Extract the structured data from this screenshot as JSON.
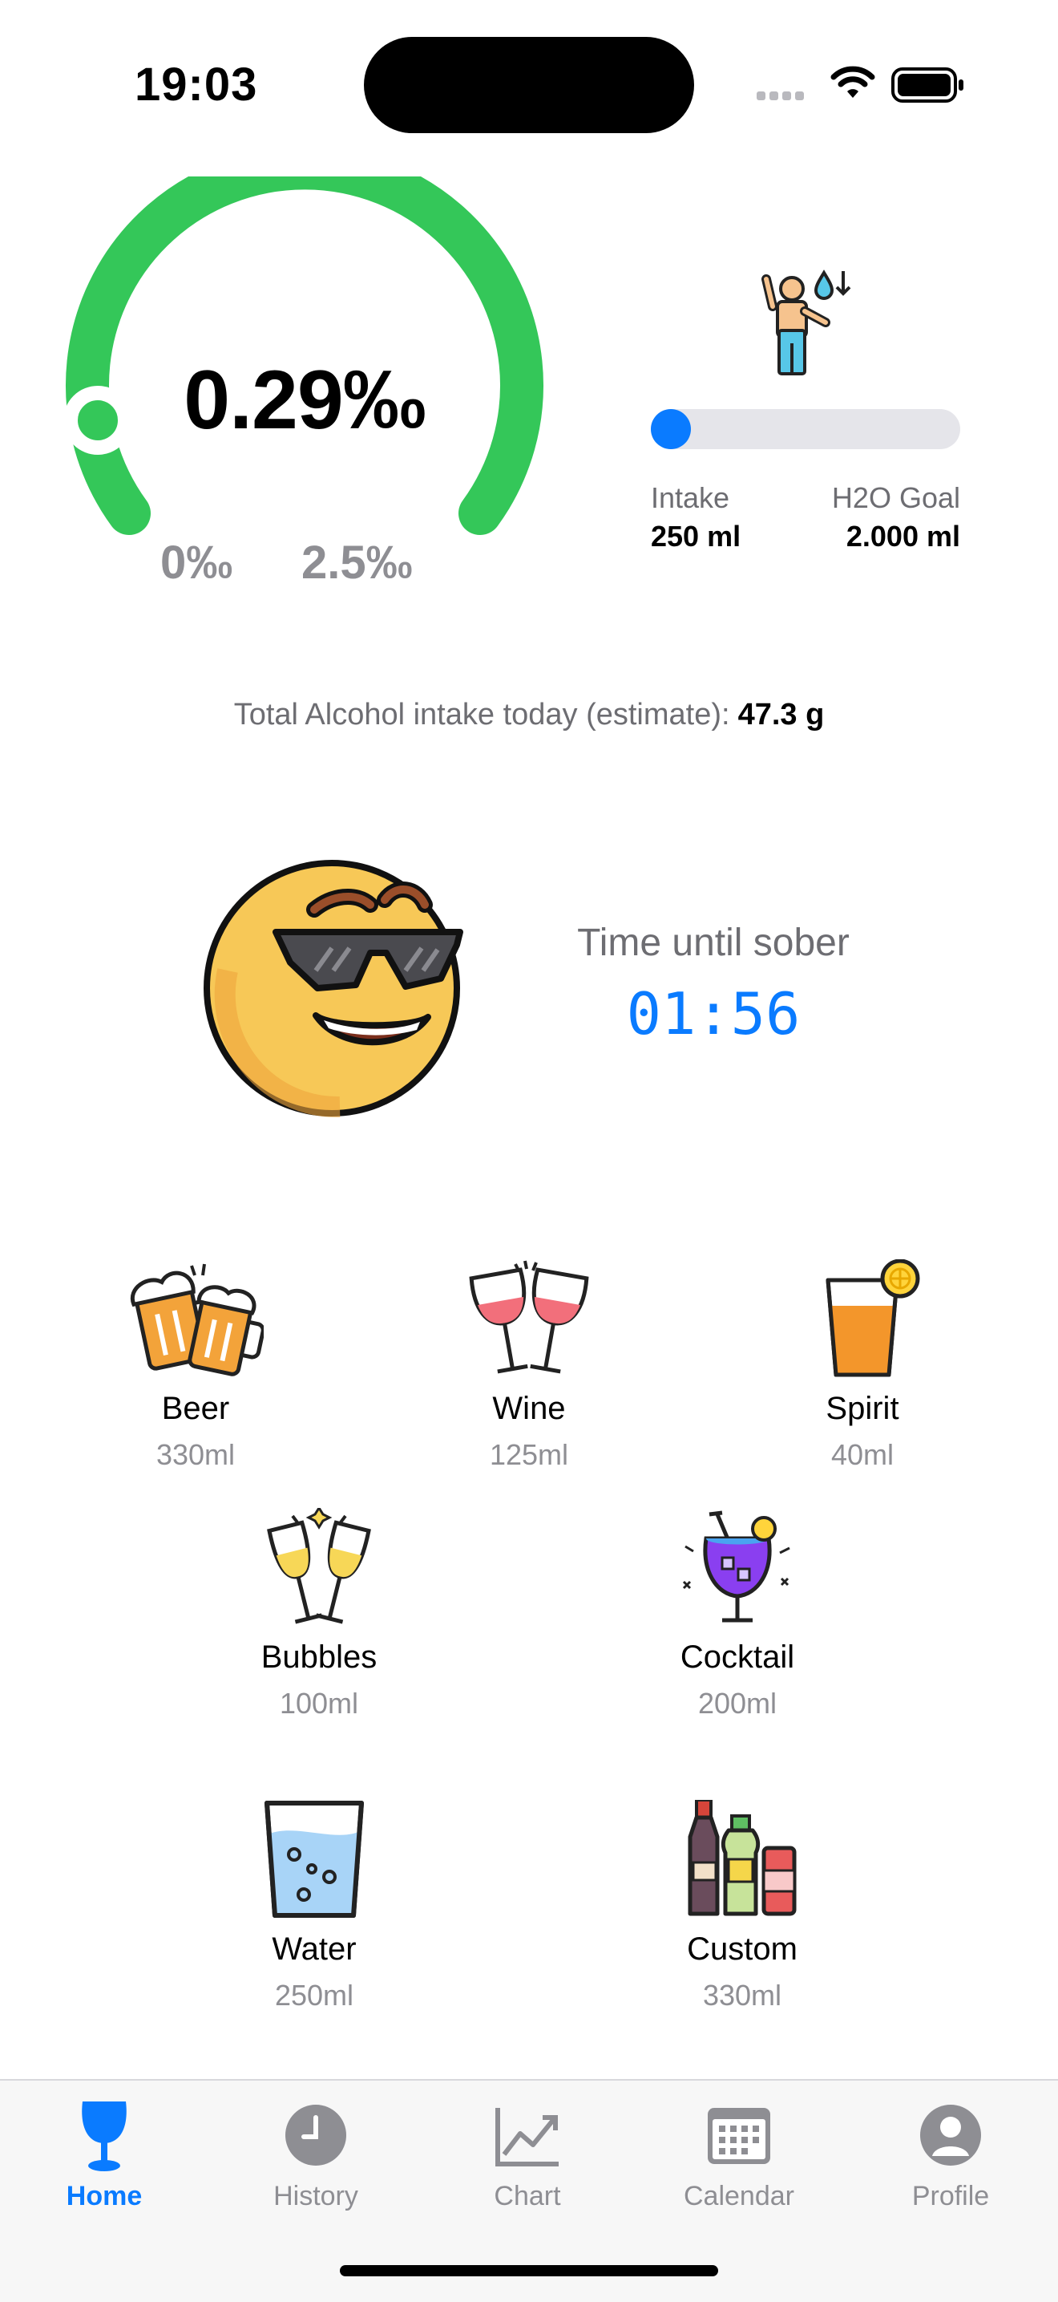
{
  "status_bar": {
    "time": "19:03"
  },
  "gauge": {
    "value": "0.29‰",
    "min_label": "0‰",
    "max_label": "2.5‰",
    "color": "#34c759"
  },
  "water": {
    "intake_label": "Intake",
    "intake_value": "250 ml",
    "goal_label": "H2O Goal",
    "goal_value": "2.000 ml",
    "progress_fraction": 0.125,
    "accent": "#0a7bff"
  },
  "total": {
    "label": "Total Alcohol intake today (estimate):",
    "value": "47.3 g"
  },
  "sober": {
    "label": "Time until sober",
    "time": "01:56"
  },
  "drinks": [
    {
      "name": "Beer",
      "volume": "330ml",
      "icon": "beer-icon"
    },
    {
      "name": "Wine",
      "volume": "125ml",
      "icon": "wine-icon"
    },
    {
      "name": "Spirit",
      "volume": "40ml",
      "icon": "spirit-icon"
    },
    {
      "name": "Bubbles",
      "volume": "100ml",
      "icon": "bubbles-icon"
    },
    {
      "name": "Cocktail",
      "volume": "200ml",
      "icon": "cocktail-icon"
    },
    {
      "name": "Water",
      "volume": "250ml",
      "icon": "water-icon"
    },
    {
      "name": "Custom",
      "volume": "330ml",
      "icon": "custom-icon"
    }
  ],
  "tabs": [
    {
      "label": "Home",
      "icon": "glass-icon",
      "active": true
    },
    {
      "label": "History",
      "icon": "clock-icon",
      "active": false
    },
    {
      "label": "Chart",
      "icon": "chart-icon",
      "active": false
    },
    {
      "label": "Calendar",
      "icon": "calendar-icon",
      "active": false
    },
    {
      "label": "Profile",
      "icon": "profile-icon",
      "active": false
    }
  ]
}
